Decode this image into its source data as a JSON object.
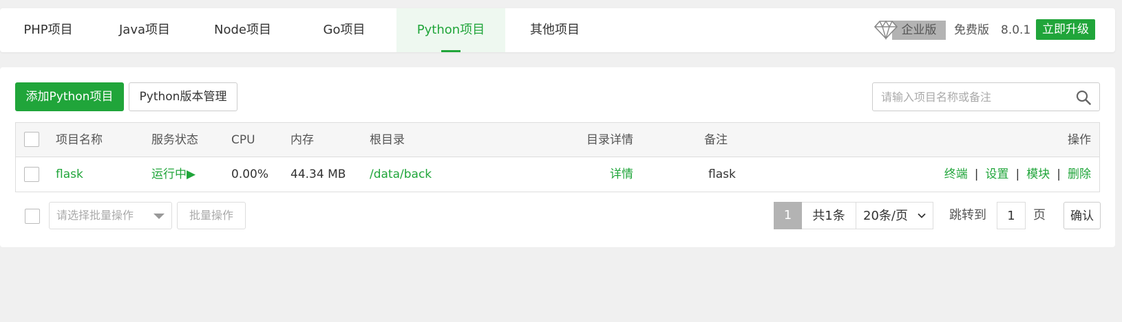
{
  "tabs": [
    {
      "label": "PHP项目"
    },
    {
      "label": "Java项目"
    },
    {
      "label": "Node项目"
    },
    {
      "label": "Go项目"
    },
    {
      "label": "Python项目",
      "active": true
    },
    {
      "label": "其他项目"
    }
  ],
  "header": {
    "edition_badge": "企业版",
    "edition_icon": "diamond-icon",
    "free_label": "免费版",
    "version": "8.0.1",
    "upgrade_label": "立即升级"
  },
  "toolbar": {
    "add_label": "添加Python项目",
    "version_mgmt_label": "Python版本管理",
    "search_placeholder": "请输入项目名称或备注",
    "search_icon": "search-icon"
  },
  "table": {
    "columns": {
      "name": "项目名称",
      "status": "服务状态",
      "cpu": "CPU",
      "memory": "内存",
      "root": "根目录",
      "dir_detail": "目录详情",
      "remark": "备注",
      "ops": "操作"
    },
    "rows": [
      {
        "name": "flask",
        "status": "运行中▶",
        "cpu": "0.00%",
        "memory": "44.34 MB",
        "root": "/data/back",
        "dir_detail": "详情",
        "remark": "flask",
        "ops": [
          "终端",
          "设置",
          "模块",
          "删除"
        ],
        "op_sep": "|"
      }
    ]
  },
  "footer": {
    "batch_select_placeholder": "请选择批量操作",
    "batch_button": "批量操作",
    "current_page": "1",
    "total": "共1条",
    "page_size": "20条/页",
    "goto_label": "跳转到",
    "goto_value": "1",
    "page_unit": "页",
    "confirm": "确认"
  },
  "colors": {
    "accent": "#20a53a",
    "background": "#f0f0f0",
    "badge_gray": "#b3b3b3"
  }
}
